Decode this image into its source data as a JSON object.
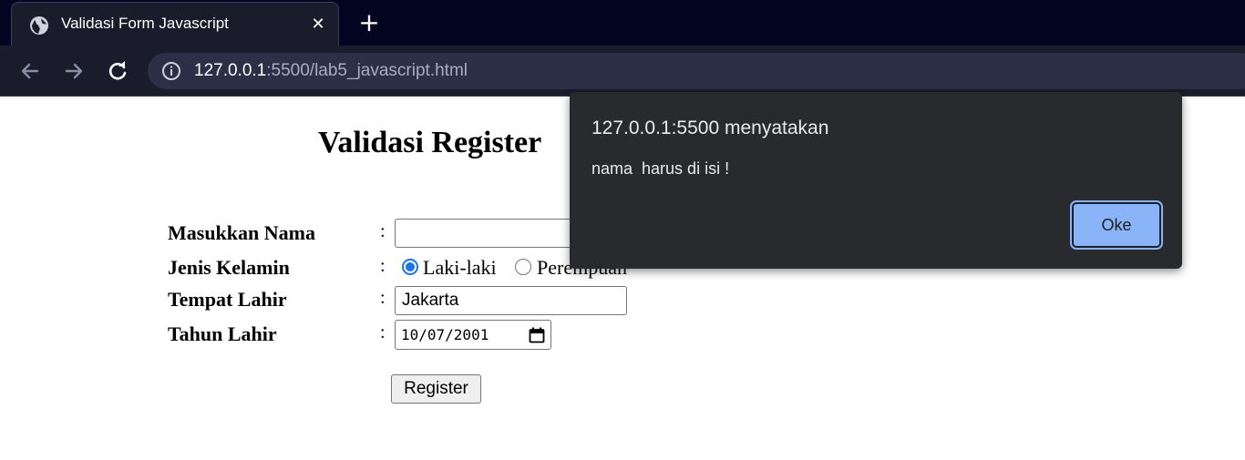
{
  "browser": {
    "tab_title": "Validasi Form Javascript",
    "url_host": "127.0.0.1",
    "url_rest": ":5500/lab5_javascript.html"
  },
  "page": {
    "title": "Validasi Register",
    "fields": {
      "nama_label": "Masukkan Nama",
      "jenis_label": "Jenis Kelamin",
      "tempat_label": "Tempat Lahir",
      "tahun_label": "Tahun Lahir",
      "colon": ":"
    },
    "nama_value": "",
    "radio_male_label": "Laki-laki",
    "radio_female_label": "Perempuan",
    "tempat_value": "Jakarta",
    "tahun_value": "10/07/2001",
    "register_label": "Register"
  },
  "dialog": {
    "title": "127.0.0.1:5500 menyatakan",
    "message": "nama  harus di isi !",
    "ok_label": "Oke"
  },
  "colors": {
    "chrome_dark": "#020420",
    "dialog_bg": "#292a2d",
    "accent": "#8ab4f8"
  }
}
